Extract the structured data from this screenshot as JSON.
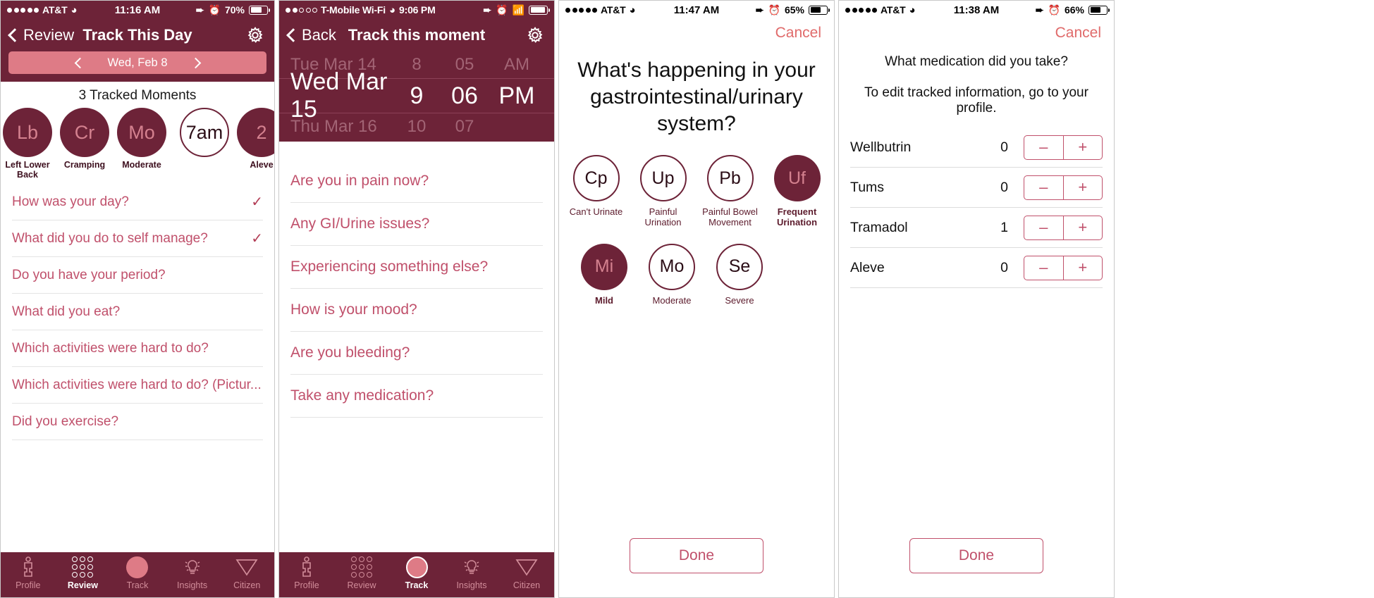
{
  "panel1": {
    "status": {
      "carrier": "AT&T",
      "signal_dots": [
        1,
        1,
        1,
        1,
        1
      ],
      "wifi_icon": "wifi-icon",
      "time": "11:16 AM",
      "location_icon": "location-arrow-icon",
      "alarm_icon": "alarm-clock-icon",
      "battery": "70%",
      "battery_level": 70
    },
    "nav": {
      "back_label": "Review",
      "title": "Track This Day",
      "gear_icon": "gear-icon"
    },
    "datebar": {
      "prev_icon": "chevron-left-icon",
      "label": "Wed, Feb 8",
      "next_icon": "chevron-right-icon"
    },
    "tracked_header": "3 Tracked Moments",
    "bubbles": [
      {
        "initials": "Lb",
        "label": "Left Lower Back",
        "filled": true
      },
      {
        "initials": "Cr",
        "label": "Cramping",
        "filled": true
      },
      {
        "initials": "Mo",
        "label": "Moderate",
        "filled": true
      },
      {
        "initials": "7am",
        "label": "",
        "filled": false
      },
      {
        "initials": "2",
        "label": "Aleve",
        "filled": true
      }
    ],
    "questions": [
      {
        "text": "How was your day?",
        "checked": true
      },
      {
        "text": "What did you do to self manage?",
        "checked": true
      },
      {
        "text": "Do you have your period?",
        "checked": false
      },
      {
        "text": "What did you eat?",
        "checked": false
      },
      {
        "text": "Which activities were hard to do?",
        "checked": false
      },
      {
        "text": "Which activities were hard to do? (Pictur...",
        "checked": false
      },
      {
        "text": "Did you exercise?",
        "checked": false
      }
    ],
    "tabs": [
      {
        "label": "Profile",
        "icon": "person-icon",
        "active": false
      },
      {
        "label": "Review",
        "icon": "dot-grid-icon",
        "active": true
      },
      {
        "label": "Track",
        "icon": "circle-icon",
        "active": false
      },
      {
        "label": "Insights",
        "icon": "lightbulb-icon",
        "active": false
      },
      {
        "label": "Citizen",
        "icon": "triangle-icon",
        "active": false
      }
    ]
  },
  "panel2": {
    "status": {
      "carrier": "T-Mobile Wi-Fi",
      "signal_dots": [
        1,
        1,
        0,
        0,
        0
      ],
      "wifi_icon": "wifi-icon",
      "time": "9:06 PM",
      "location_icon": "location-arrow-icon",
      "alarm_icon": "alarm-clock-icon",
      "bluetooth_icon": "bluetooth-icon",
      "battery_level": 95
    },
    "nav": {
      "back_label": "Back",
      "title": "Track this moment",
      "gear_icon": "gear-icon"
    },
    "picker": {
      "rows": [
        {
          "date": "Tue Mar 14",
          "hour": "8",
          "minute": "05",
          "ampm": "AM",
          "selected": false
        },
        {
          "date": "Wed Mar 15",
          "hour": "9",
          "minute": "06",
          "ampm": "PM",
          "selected": true
        },
        {
          "date": "Thu Mar 16",
          "hour": "10",
          "minute": "07",
          "ampm": "",
          "selected": false
        }
      ]
    },
    "questions": [
      {
        "text": "Are you in pain now?"
      },
      {
        "text": "Any GI/Urine issues?"
      },
      {
        "text": "Experiencing something else?"
      },
      {
        "text": "How is your mood?"
      },
      {
        "text": "Are you bleeding?"
      },
      {
        "text": "Take any medication?"
      }
    ],
    "tabs": [
      {
        "label": "Profile",
        "icon": "person-icon",
        "active": false
      },
      {
        "label": "Review",
        "icon": "dot-grid-icon",
        "active": false
      },
      {
        "label": "Track",
        "icon": "circle-icon",
        "active": true
      },
      {
        "label": "Insights",
        "icon": "lightbulb-icon",
        "active": false
      },
      {
        "label": "Citizen",
        "icon": "triangle-icon",
        "active": false
      }
    ]
  },
  "panel3": {
    "status": {
      "carrier": "AT&T",
      "signal_dots": [
        1,
        1,
        1,
        1,
        1
      ],
      "wifi_icon": "wifi-icon",
      "time": "11:47 AM",
      "location_icon": "location-arrow-icon",
      "alarm_icon": "alarm-clock-icon",
      "battery": "65%",
      "battery_level": 65
    },
    "cancel_label": "Cancel",
    "question": "What's happening in your gastrointestinal/urinary system?",
    "symptoms": [
      {
        "initials": "Cp",
        "label": "Can't Urinate",
        "selected": false
      },
      {
        "initials": "Up",
        "label": "Painful Urination",
        "selected": false
      },
      {
        "initials": "Pb",
        "label": "Painful Bowel Movement",
        "selected": false
      },
      {
        "initials": "Uf",
        "label": "Frequent Urination",
        "selected": true
      }
    ],
    "severities": [
      {
        "initials": "Mi",
        "label": "Mild",
        "selected": true
      },
      {
        "initials": "Mo",
        "label": "Moderate",
        "selected": false
      },
      {
        "initials": "Se",
        "label": "Severe",
        "selected": false
      }
    ],
    "done_label": "Done"
  },
  "panel4": {
    "status": {
      "carrier": "AT&T",
      "signal_dots": [
        1,
        1,
        1,
        1,
        1
      ],
      "wifi_icon": "wifi-icon",
      "time": "11:38 AM",
      "location_icon": "location-arrow-icon",
      "alarm_icon": "alarm-clock-icon",
      "battery": "66%",
      "battery_level": 66
    },
    "cancel_label": "Cancel",
    "question": "What medication did you take?",
    "subtitle": "To edit tracked information, go to your profile.",
    "medications": [
      {
        "name": "Wellbutrin",
        "count": "0",
        "minus": "–",
        "plus": "+"
      },
      {
        "name": "Tums",
        "count": "0",
        "minus": "–",
        "plus": "+"
      },
      {
        "name": "Tramadol",
        "count": "1",
        "minus": "–",
        "plus": "+"
      },
      {
        "name": "Aleve",
        "count": "0",
        "minus": "–",
        "plus": "+"
      }
    ],
    "done_label": "Done"
  },
  "colors": {
    "brand_dark": "#6d2338",
    "brand_light": "#de7b86",
    "link": "#c0506b",
    "cancel": "#e06a6a"
  }
}
